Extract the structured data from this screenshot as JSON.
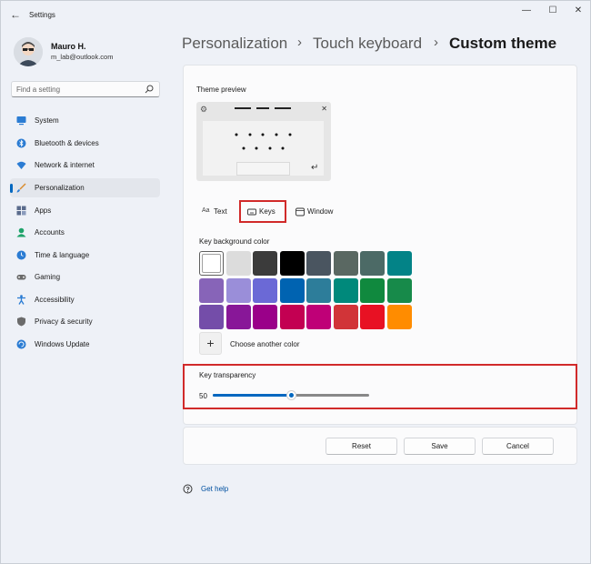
{
  "app": {
    "title": "Settings"
  },
  "window_controls": {
    "minimize": "—",
    "maximize": "☐",
    "close": "✕"
  },
  "user": {
    "name": "Mauro H.",
    "email": "m_lab@outlook.com"
  },
  "search": {
    "placeholder": "Find a setting"
  },
  "sidebar": {
    "items": [
      {
        "label": "System",
        "icon": "monitor-icon",
        "color": "#2b7cd3"
      },
      {
        "label": "Bluetooth & devices",
        "icon": "bluetooth-icon",
        "color": "#2b7cd3"
      },
      {
        "label": "Network & internet",
        "icon": "wifi-icon",
        "color": "#2b7cd3"
      },
      {
        "label": "Personalization",
        "icon": "brush-icon",
        "color": "#d98a2b",
        "active": true
      },
      {
        "label": "Apps",
        "icon": "apps-icon",
        "color": "#5a6b8c"
      },
      {
        "label": "Accounts",
        "icon": "person-icon",
        "color": "#1fa36a"
      },
      {
        "label": "Time & language",
        "icon": "globe-clock-icon",
        "color": "#2b7cd3"
      },
      {
        "label": "Gaming",
        "icon": "controller-icon",
        "color": "#6b6b6b"
      },
      {
        "label": "Accessibility",
        "icon": "accessibility-icon",
        "color": "#2b7cd3"
      },
      {
        "label": "Privacy & security",
        "icon": "shield-icon",
        "color": "#6b6b6b"
      },
      {
        "label": "Windows Update",
        "icon": "update-icon",
        "color": "#2b7cd3"
      }
    ]
  },
  "breadcrumb": {
    "items": [
      "Personalization",
      "Touch keyboard",
      "Custom theme"
    ],
    "separator": "›"
  },
  "theme_preview": {
    "label": "Theme preview",
    "gear_icon": "⚙",
    "close_icon": "✕",
    "enter_icon": "↵"
  },
  "tabs": [
    {
      "label": "Text",
      "icon": "Aa"
    },
    {
      "label": "Keys",
      "icon": "keyboard-icon",
      "selected": true
    },
    {
      "label": "Window",
      "icon": "window-icon"
    }
  ],
  "key_background": {
    "label": "Key background color",
    "colors": [
      [
        "#ffffff",
        "#dcdcdc",
        "#3b3b3b",
        "#000000",
        "#4a5560",
        "#5a6862",
        "#4c6a66",
        "#038387"
      ],
      [
        "#8764b8",
        "#9a8ed9",
        "#6b69d6",
        "#0063b1",
        "#2d7d9a",
        "#00897b",
        "#10893e",
        "#178a4a"
      ],
      [
        "#744da9",
        "#881798",
        "#9a0089",
        "#c30052",
        "#bf0077",
        "#d13438",
        "#e81123",
        "#ff8c00"
      ]
    ],
    "selected_index": 0,
    "choose_another_label": "Choose another color",
    "add_symbol": "+"
  },
  "key_transparency": {
    "label": "Key transparency",
    "value": "50",
    "level": 0.5
  },
  "actions": {
    "reset": "Reset",
    "save": "Save",
    "cancel": "Cancel"
  },
  "help": {
    "label": "Get help"
  },
  "colors": {
    "accent": "#0067c0",
    "highlight": "#d12a2a"
  }
}
